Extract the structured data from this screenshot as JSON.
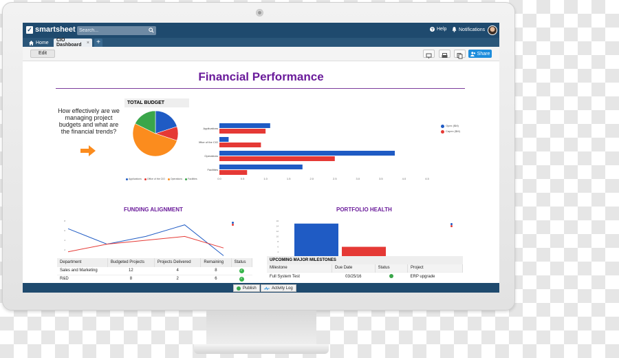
{
  "app": {
    "logo_text": "smartsheet",
    "logo_mark": "✓"
  },
  "search": {
    "placeholder": "Search..."
  },
  "topbar": {
    "help_label": "Help",
    "notifications_label": "Notifications"
  },
  "tabs": {
    "home_label": "Home",
    "active_label": "CIO Dashboard",
    "close_glyph": "×",
    "add_glyph": "+"
  },
  "toolbar": {
    "edit_label": "Edit",
    "share_label": "Share"
  },
  "dashboard": {
    "title": "Financial Performance",
    "question": "How effectively are we managing project budgets and what are the financial trends?",
    "budget_title": "TOTAL BUDGET",
    "funding_title": "FUNDING ALIGNMENT",
    "portfolio_title": "PORTFOLIO HEALTH"
  },
  "colors": {
    "blue": "#1f5bc4",
    "red": "#e53935",
    "green": "#3aa64a",
    "orange": "#fb8c1e",
    "purple": "#6a1b9a"
  },
  "chart_data": [
    {
      "type": "pie",
      "title": "TOTAL BUDGET",
      "categories": [
        "Applications",
        "Office of the CIO",
        "Operations",
        "Facilities"
      ],
      "values": [
        1.8,
        0.9,
        4.7,
        1.6
      ],
      "colors": [
        "#1f5bc4",
        "#e53935",
        "#fb8c1e",
        "#3aa64a"
      ]
    },
    {
      "type": "bar",
      "orientation": "horizontal",
      "categories": [
        "Applications",
        "Office of the CIO",
        "Operations",
        "Facilities"
      ],
      "series": [
        {
          "name": "Opex ($M)",
          "values": [
            1.1,
            0.2,
            3.8,
            1.8
          ]
        },
        {
          "name": "Capex ($M)",
          "values": [
            1.0,
            0.9,
            2.5,
            0.6
          ]
        }
      ],
      "xticks": [
        "0.0",
        "0.5",
        "1.0",
        "1.5",
        "2.0",
        "2.5",
        "3.0",
        "3.5",
        "4.0",
        "4.5"
      ],
      "xlim": [
        0,
        4.5
      ],
      "legend": "right",
      "colors": [
        "#1f5bc4",
        "#e53935"
      ]
    },
    {
      "type": "line",
      "title": "FUNDING ALIGNMENT",
      "x": [
        1,
        2,
        3,
        4,
        5
      ],
      "series": [
        {
          "values": [
            8,
            4,
            6,
            9,
            1
          ]
        },
        {
          "values": [
            2,
            4,
            5,
            6,
            3
          ]
        }
      ],
      "ylim": [
        0,
        10
      ],
      "yticks": [
        "8",
        "6",
        "4",
        "2",
        "0"
      ],
      "legend": "top-right",
      "colors": [
        "#1f5bc4",
        "#e53935"
      ]
    },
    {
      "type": "bar",
      "title": "PORTFOLIO HEALTH",
      "series": [
        {
          "values": [
            15
          ]
        },
        {
          "values": [
            6
          ]
        }
      ],
      "ylim": [
        0,
        16
      ],
      "yticks": [
        "16",
        "14",
        "12",
        "10",
        "8",
        "6",
        "4",
        "2",
        "0"
      ],
      "legend": "top-right",
      "colors": [
        "#1f5bc4",
        "#e53935"
      ]
    }
  ],
  "dept_table": {
    "headers": [
      "Department",
      "Budgeted Projects",
      "Projects Delivered",
      "Remaining",
      "Status"
    ],
    "rows": [
      [
        "Sales and Marketing",
        "12",
        "4",
        "8",
        "✓"
      ],
      [
        "R&D",
        "8",
        "2",
        "6",
        "✓"
      ]
    ]
  },
  "milestones": {
    "title": "UPCOMING MAJOR MILESTONES",
    "headers": [
      "Milestone",
      "Due Date",
      "Status",
      "Project"
    ],
    "rows": [
      {
        "milestone": "Full System Test",
        "due": "03/25/16",
        "status_color": "#3aa64a",
        "project": "ERP upgrade"
      }
    ]
  },
  "bottombar": {
    "publish_label": "Publish",
    "activity_label": "Activity Log"
  }
}
